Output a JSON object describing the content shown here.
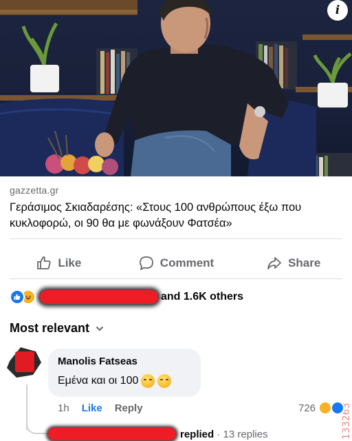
{
  "post": {
    "link_domain": "gazzetta.gr",
    "headline": "Γεράσιμος Σκιαδαρέσης: «Στους 100 ανθρώπους έξω που κυκλοφορώ, οι 90 θα με φωνάξουν Φατσέα»"
  },
  "actions": {
    "like": "Like",
    "comment": "Comment",
    "share": "Share"
  },
  "reactions": {
    "others_text": "and 1.6K others",
    "icons": [
      "like-icon",
      "haha-icon"
    ]
  },
  "filter": {
    "label": "Most relevant"
  },
  "comment": {
    "author": "Manolis Fatseas",
    "text": "Εμένα και οι 100",
    "emojis": [
      "wink-emoji",
      "wink-emoji"
    ],
    "time": "1h",
    "like_label": "Like",
    "reply_label": "Reply",
    "reaction_count": "726"
  },
  "reply_summary": {
    "replied_label": "replied",
    "separator": "·",
    "count_text": "13 replies"
  },
  "watermark": "133263",
  "colors": {
    "facebook_blue": "#1877f2",
    "muted_text": "#65676b",
    "redaction": "#ee1c25",
    "bubble_bg": "#f0f2f5"
  }
}
